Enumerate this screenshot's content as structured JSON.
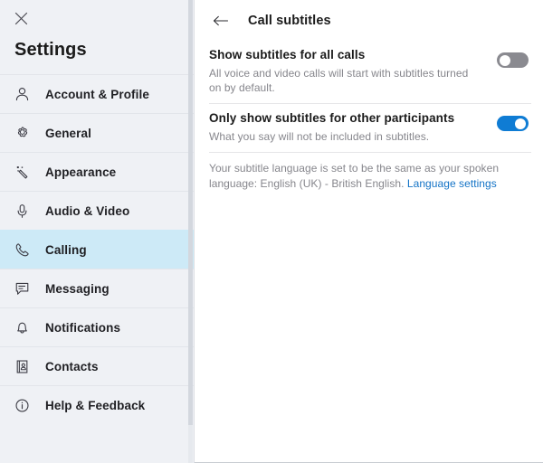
{
  "sidebar": {
    "close_icon": "close-icon",
    "title": "Settings",
    "items": [
      {
        "label": "Account & Profile",
        "icon": "person-icon",
        "selected": false
      },
      {
        "label": "General",
        "icon": "gear-icon",
        "selected": false
      },
      {
        "label": "Appearance",
        "icon": "magic-wand-icon",
        "selected": false
      },
      {
        "label": "Audio & Video",
        "icon": "microphone-icon",
        "selected": false
      },
      {
        "label": "Calling",
        "icon": "phone-icon",
        "selected": true
      },
      {
        "label": "Messaging",
        "icon": "chat-bubble-icon",
        "selected": false
      },
      {
        "label": "Notifications",
        "icon": "bell-icon",
        "selected": false
      },
      {
        "label": "Contacts",
        "icon": "address-book-icon",
        "selected": false
      },
      {
        "label": "Help & Feedback",
        "icon": "info-circle-icon",
        "selected": false
      }
    ]
  },
  "main": {
    "back_icon": "back-arrow-icon",
    "title": "Call subtitles",
    "settings": [
      {
        "name": "Show subtitles for all calls",
        "description": "All voice and video calls will start with subtitles turned on by default.",
        "toggle_state": "off"
      },
      {
        "name": "Only show subtitles for other participants",
        "description": "What you say will not be included in subtitles.",
        "toggle_state": "on"
      }
    ],
    "note": {
      "text": "Your subtitle language is set to be the same as your spoken language: English (UK) - British English. ",
      "link_label": "Language settings"
    }
  },
  "colors": {
    "accent": "#0f7cd4",
    "link": "#1373c6",
    "sidebar_bg": "#eff1f5",
    "selected_bg": "#cdeaf7",
    "toggle_off": "#8a8a90"
  }
}
